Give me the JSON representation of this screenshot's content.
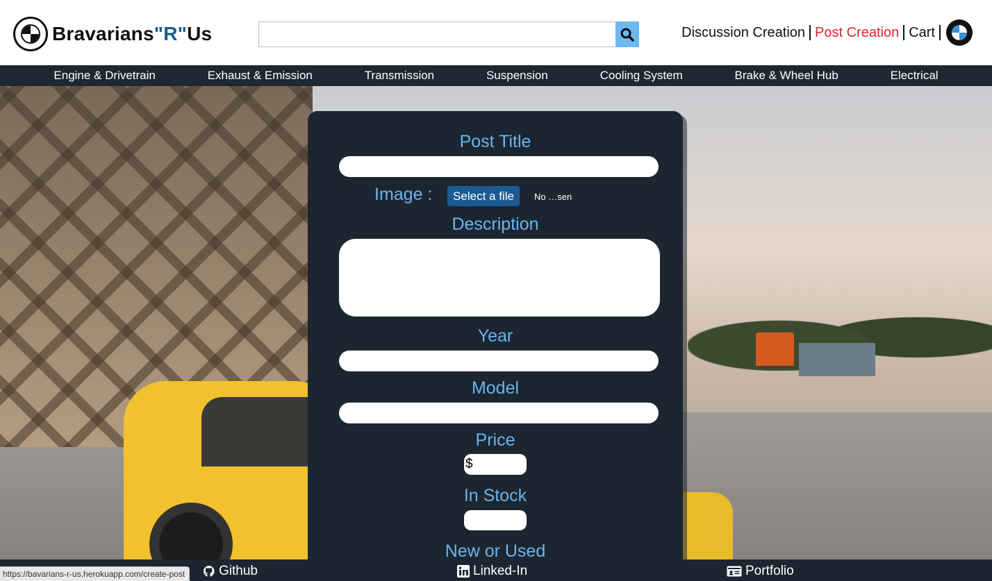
{
  "brand": {
    "name_prefix": "Bravarians",
    "name_r": "\"R\"",
    "name_suffix": "Us"
  },
  "search": {
    "value": "",
    "icon": "search-icon"
  },
  "topnav": {
    "discussion": "Discussion Creation",
    "post": "Post Creation",
    "cart": "Cart",
    "active_color": "#e0242e"
  },
  "categories": [
    "Engine & Drivetrain",
    "Exhaust & Emission",
    "Transmission",
    "Suspension",
    "Cooling System",
    "Brake & Wheel Hub",
    "Electrical"
  ],
  "form": {
    "post_title_label": "Post Title",
    "post_title_value": "",
    "image_label": "Image :",
    "file_button": "Select a file",
    "file_status": "No …sen",
    "description_label": "Description",
    "description_value": "",
    "year_label": "Year",
    "year_value": "",
    "model_label": "Model",
    "model_value": "",
    "price_label": "Price",
    "price_currency": "$",
    "price_value": "",
    "stock_label": "In Stock",
    "stock_value": "",
    "condition_label": "New or Used"
  },
  "footer": {
    "github": "Github",
    "linkedin": "Linked-In",
    "portfolio": "Portfolio"
  },
  "status_url": "https://bavarians-r-us.herokuapp.com/create-post",
  "colors": {
    "accent": "#6ab4ef",
    "panel": "#1c2630",
    "file_button": "#1c5a92"
  }
}
